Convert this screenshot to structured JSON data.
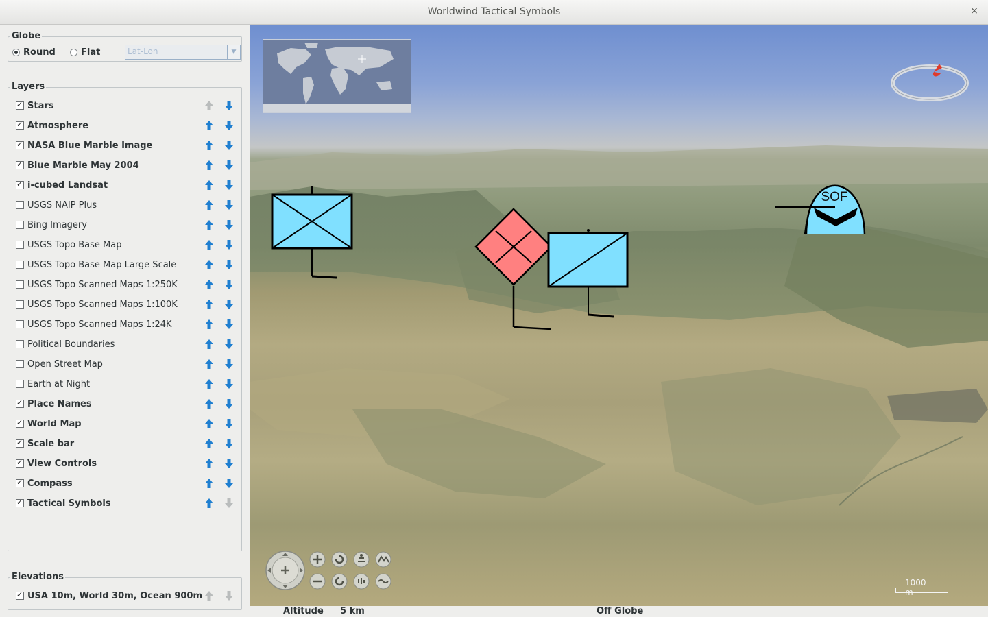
{
  "window": {
    "title": "Worldwind Tactical Symbols",
    "close_glyph": "×"
  },
  "globe": {
    "legend": "Globe",
    "round_label": "Round",
    "flat_label": "Flat",
    "selected": "Round",
    "projection_value": "Lat-Lon"
  },
  "layers": {
    "legend": "Layers",
    "items": [
      {
        "label": "Stars",
        "enabled": true
      },
      {
        "label": "Atmosphere",
        "enabled": true
      },
      {
        "label": "NASA Blue Marble Image",
        "enabled": true
      },
      {
        "label": "Blue Marble May 2004",
        "enabled": true
      },
      {
        "label": "i-cubed Landsat",
        "enabled": true
      },
      {
        "label": "USGS NAIP Plus",
        "enabled": false
      },
      {
        "label": "Bing Imagery",
        "enabled": false
      },
      {
        "label": "USGS Topo Base Map",
        "enabled": false
      },
      {
        "label": "USGS Topo Base Map Large Scale",
        "enabled": false
      },
      {
        "label": "USGS Topo Scanned Maps 1:250K",
        "enabled": false
      },
      {
        "label": "USGS Topo Scanned Maps 1:100K",
        "enabled": false
      },
      {
        "label": "USGS Topo Scanned Maps 1:24K",
        "enabled": false
      },
      {
        "label": "Political Boundaries",
        "enabled": false
      },
      {
        "label": "Open Street Map",
        "enabled": false
      },
      {
        "label": "Earth at Night",
        "enabled": false
      },
      {
        "label": "Place Names",
        "enabled": true
      },
      {
        "label": "World Map",
        "enabled": true
      },
      {
        "label": "Scale bar",
        "enabled": true
      },
      {
        "label": "View Controls",
        "enabled": true
      },
      {
        "label": "Compass",
        "enabled": true
      },
      {
        "label": "Tactical Symbols",
        "enabled": true
      }
    ]
  },
  "elevations": {
    "legend": "Elevations",
    "items": [
      {
        "label": "USA 10m, World 30m, Ocean 900m",
        "enabled": true
      }
    ]
  },
  "viewport": {
    "scale_label": "1000 m",
    "sof_symbol_text": "SOF",
    "symbols": [
      {
        "name": "friendly-infantry-unit",
        "color": "#80e0ff"
      },
      {
        "name": "hostile-infantry-unit",
        "color": "#ff8080"
      },
      {
        "name": "friendly-armor-unit",
        "color": "#80e0ff"
      },
      {
        "name": "friendly-sof-unit",
        "color": "#80e0ff"
      }
    ]
  },
  "status": {
    "altitude_label": "Altitude",
    "altitude_value": "5 km",
    "position": "Off Globe"
  },
  "colors": {
    "friendly": "#80e0ff",
    "hostile": "#ff8080",
    "arrow_active": "#1f7fd0",
    "arrow_disabled": "#b9bcbc"
  }
}
